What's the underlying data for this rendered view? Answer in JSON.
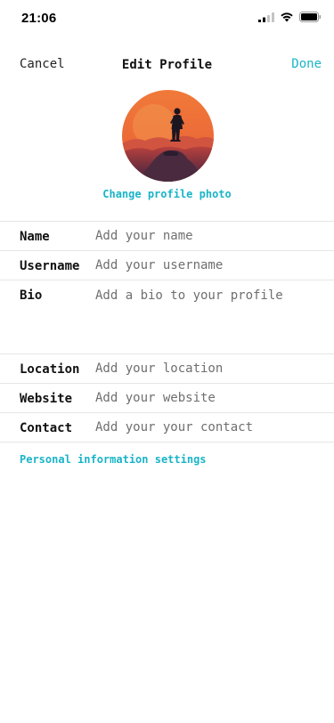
{
  "status_bar": {
    "time": "21:06"
  },
  "nav": {
    "cancel_label": "Cancel",
    "title": "Edit Profile",
    "done_label": "Done"
  },
  "profile": {
    "change_photo_label": "Change profile photo"
  },
  "form": {
    "fields": [
      {
        "label": "Name",
        "placeholder": "Add your name"
      },
      {
        "label": "Username",
        "placeholder": "Add your username"
      },
      {
        "label": "Bio",
        "placeholder": "Add a bio to your profile"
      },
      {
        "label": "Location",
        "placeholder": "Add your location"
      },
      {
        "label": "Website",
        "placeholder": "Add your website"
      },
      {
        "label": "Contact",
        "placeholder": "Add your your contact"
      }
    ]
  },
  "personal_info_label": "Personal information settings",
  "colors": {
    "accent": "#1ab4c8",
    "label": "#111111",
    "placeholder": "#6f6f6f",
    "divider": "#e6e6e6"
  },
  "icons": {
    "signal": "signal-icon",
    "wifi": "wifi-icon",
    "battery": "battery-icon"
  }
}
